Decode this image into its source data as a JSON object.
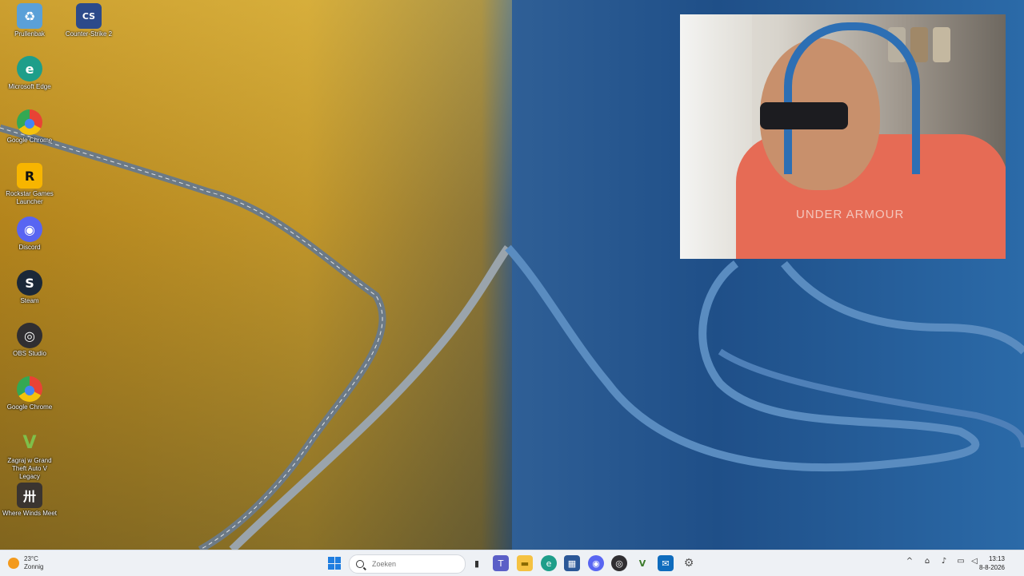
{
  "desktop_icons": [
    {
      "label": "Prullenbak",
      "icon": "recycle-bin-icon",
      "color": "#5aa0d8",
      "glyph": "♻"
    },
    {
      "label": "Counter-Strike 2",
      "icon": "counter-strike-icon",
      "color": "#2c4a8a",
      "glyph": "CS"
    },
    {
      "label": "Microsoft Edge",
      "icon": "edge-icon",
      "color": "#1e9e8a",
      "glyph": "e"
    },
    {
      "label": "Google Chrome",
      "icon": "chrome-icon",
      "color": "#e84335",
      "glyph": "●"
    },
    {
      "label": "Rockstar Games Launcher",
      "icon": "rockstar-icon",
      "color": "#f7b500",
      "glyph": "R"
    },
    {
      "label": "Discord",
      "icon": "discord-icon",
      "color": "#5865f2",
      "glyph": "◉"
    },
    {
      "label": "Steam",
      "icon": "steam-icon",
      "color": "#1b2838",
      "glyph": "S"
    },
    {
      "label": "OBS Studio",
      "icon": "obs-icon",
      "color": "#302e31",
      "glyph": "◎"
    },
    {
      "label": "Google Chrome",
      "icon": "chrome-icon",
      "color": "#e84335",
      "glyph": "●"
    },
    {
      "label": "Zagraj w Grand Theft Auto V Legacy",
      "icon": "gta-v-icon",
      "color": "#3b7a2a",
      "glyph": "V"
    },
    {
      "label": "Where Winds Meet",
      "icon": "where-winds-meet-icon",
      "color": "#3a3430",
      "glyph": "卅"
    }
  ],
  "webcam": {
    "shirt_text": "UNDER ARMOUR"
  },
  "taskbar": {
    "weather": {
      "temperature": "23°C",
      "condition": "Zonnig"
    },
    "search_placeholder": "Zoeken",
    "apps": [
      {
        "icon": "task-view-icon",
        "color": "#333333",
        "glyph": "▮"
      },
      {
        "icon": "teams-icon",
        "color": "#5b5fc7",
        "glyph": "T"
      },
      {
        "icon": "file-explorer-icon",
        "color": "#f5c242",
        "glyph": "▬"
      },
      {
        "icon": "edge-icon",
        "color": "#1e9e8a",
        "glyph": "e"
      },
      {
        "icon": "store-icon",
        "color": "#2b5797",
        "glyph": "▦"
      },
      {
        "icon": "discord-icon",
        "color": "#5865f2",
        "glyph": "◉"
      },
      {
        "icon": "obs-icon",
        "color": "#302e31",
        "glyph": "◎"
      },
      {
        "icon": "gta-v-icon",
        "color": "#3b7a2a",
        "glyph": "V"
      },
      {
        "icon": "outlook-icon",
        "color": "#0f6cbd",
        "glyph": "✉"
      },
      {
        "icon": "settings-icon",
        "color": "#6a6a6a",
        "glyph": "⚙"
      }
    ],
    "tray": [
      {
        "icon": "chevron-up-icon",
        "glyph": "^"
      },
      {
        "icon": "network-icon",
        "glyph": "⌂"
      },
      {
        "icon": "microphone-icon",
        "glyph": "♪"
      },
      {
        "icon": "display-icon",
        "glyph": "▭"
      },
      {
        "icon": "volume-icon",
        "glyph": "◁"
      }
    ],
    "clock": {
      "time": "13:13",
      "date": "8-8-2026"
    }
  }
}
